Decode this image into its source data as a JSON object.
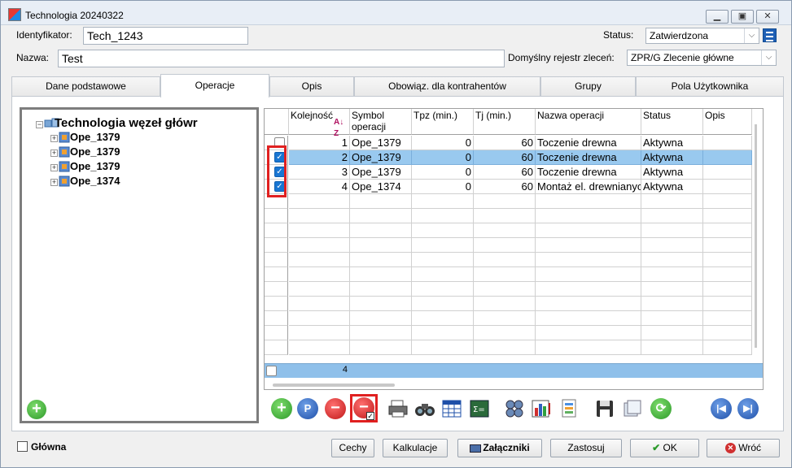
{
  "window": {
    "title": "Technologia 20240322"
  },
  "form": {
    "id_label": "Identyfikator:",
    "id_value": "Tech_1243",
    "name_label": "Nazwa:",
    "name_value": "Test",
    "status_label": "Status:",
    "status_value": "Zatwierdzona",
    "register_label": "Domyślny rejestr zleceń:",
    "register_value": "ZPR/G  Zlecenie główne"
  },
  "tabs": [
    "Dane podstawowe",
    "Operacje",
    "Opis",
    "Obowiąz. dla kontrahentów",
    "Grupy",
    "Pola Użytkownika"
  ],
  "tree": {
    "root": "Technologia węzeł główr",
    "nodes": [
      "Ope_1379",
      "Ope_1379",
      "Ope_1379",
      "Ope_1374"
    ]
  },
  "grid": {
    "headers": [
      "Kolejność",
      "Symbol operacji",
      "Tpz (min.)",
      "Tj (min.)",
      "Nazwa operacji",
      "Status",
      "Opis"
    ],
    "rows": [
      {
        "seq": "1",
        "symbol": "Ope_1379",
        "tpz": "0",
        "tj": "60",
        "name": "Toczenie drewna",
        "status": "Aktywna",
        "checked": false
      },
      {
        "seq": "2",
        "symbol": "Ope_1379",
        "tpz": "0",
        "tj": "60",
        "name": "Toczenie drewna",
        "status": "Aktywna",
        "checked": true
      },
      {
        "seq": "3",
        "symbol": "Ope_1379",
        "tpz": "0",
        "tj": "60",
        "name": "Toczenie drewna",
        "status": "Aktywna",
        "checked": true
      },
      {
        "seq": "4",
        "symbol": "Ope_1374",
        "tpz": "0",
        "tj": "60",
        "name": "Montaż el. drewnianych",
        "status": "Aktywna",
        "checked": true
      }
    ],
    "footer_count": "4"
  },
  "bottom": {
    "main_label": "Główna",
    "cechy": "Cechy",
    "kalkulacje": "Kalkulacje",
    "zalaczniki": "Załączniki",
    "zastosuj": "Zastosuj",
    "ok": "OK",
    "wroc": "Wróć"
  }
}
